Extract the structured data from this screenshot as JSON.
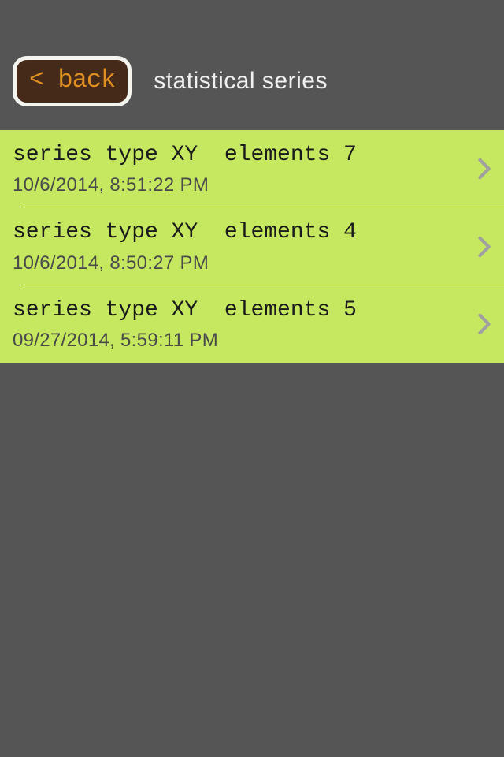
{
  "header": {
    "back_label": "< back",
    "title": "statistical series"
  },
  "list": {
    "items": [
      {
        "title": "series type XY  elements 7",
        "timestamp": "10/6/2014, 8:51:22 PM"
      },
      {
        "title": "series type XY  elements 4",
        "timestamp": "10/6/2014, 8:50:27 PM"
      },
      {
        "title": "series type XY  elements 5",
        "timestamp": "09/27/2014, 5:59:11 PM"
      }
    ]
  }
}
